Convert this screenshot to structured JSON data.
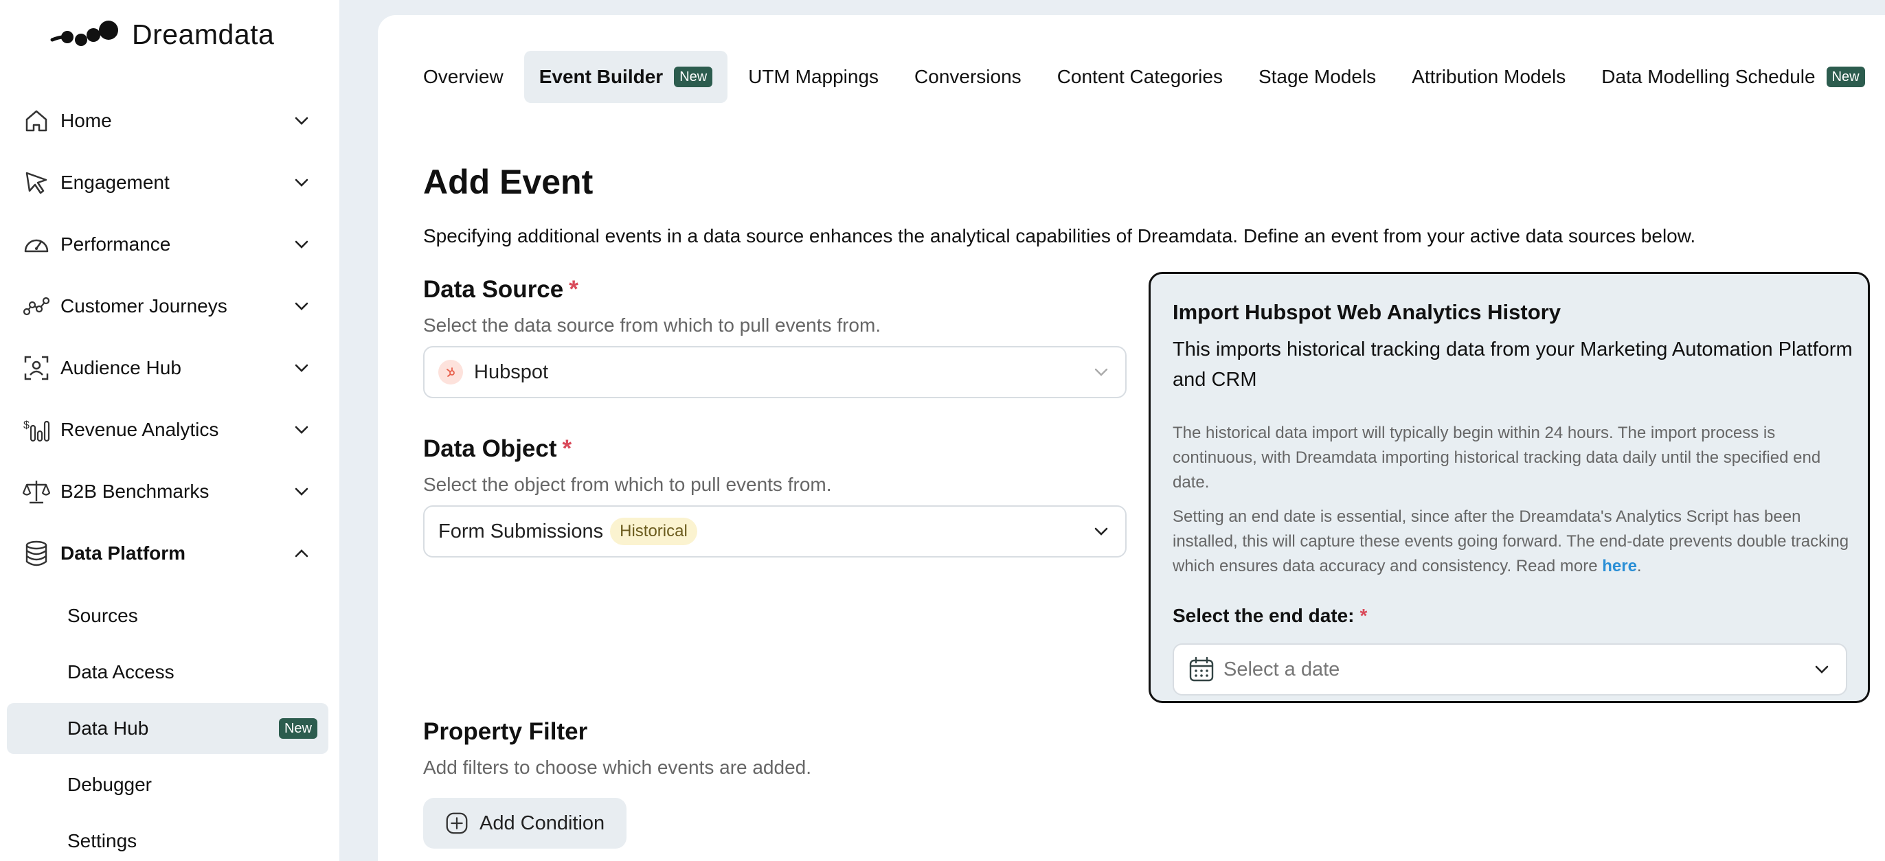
{
  "brand": {
    "name": "Dreamdata"
  },
  "sidebar": {
    "items": [
      {
        "label": "Home",
        "icon": "home-icon",
        "expanded": false
      },
      {
        "label": "Engagement",
        "icon": "cursor-icon",
        "expanded": false
      },
      {
        "label": "Performance",
        "icon": "gauge-icon",
        "expanded": false
      },
      {
        "label": "Customer Journeys",
        "icon": "journey-icon",
        "expanded": false
      },
      {
        "label": "Audience Hub",
        "icon": "audience-icon",
        "expanded": false
      },
      {
        "label": "Revenue Analytics",
        "icon": "revenue-icon",
        "expanded": false
      },
      {
        "label": "B2B Benchmarks",
        "icon": "scale-icon",
        "expanded": false
      },
      {
        "label": "Data Platform",
        "icon": "database-icon",
        "expanded": true
      }
    ],
    "sub_items": [
      {
        "label": "Sources"
      },
      {
        "label": "Data Access"
      },
      {
        "label": "Data Hub",
        "badge": "New",
        "active": true
      },
      {
        "label": "Debugger"
      },
      {
        "label": "Settings"
      }
    ]
  },
  "tabs": [
    {
      "label": "Overview"
    },
    {
      "label": "Event Builder",
      "badge": "New",
      "active": true
    },
    {
      "label": "UTM Mappings"
    },
    {
      "label": "Conversions"
    },
    {
      "label": "Content Categories"
    },
    {
      "label": "Stage Models"
    },
    {
      "label": "Attribution Models"
    },
    {
      "label": "Data Modelling Schedule",
      "badge": "New"
    }
  ],
  "page": {
    "title": "Add Event",
    "intro": "Specifying additional events in a data source enhances the analytical capabilities of Dreamdata. Define an event from your active data sources below."
  },
  "data_source": {
    "title": "Data Source",
    "required": "*",
    "help": "Select the data source from which to pull events from.",
    "value": "Hubspot"
  },
  "data_object": {
    "title": "Data Object",
    "required": "*",
    "help": "Select the object from which to pull events from.",
    "value": "Form Submissions",
    "tag": "Historical"
  },
  "import_panel": {
    "title": "Import Hubspot Web Analytics History",
    "subtitle": "This imports historical tracking data from your Marketing Automation Platform and CRM",
    "para1": "The historical data import will typically begin within 24 hours. The import process is continuous, with Dreamdata importing historical tracking data daily until the specified end date.",
    "para2": "Setting an end date is essential, since after the Dreamdata's Analytics Script has been installed, this will capture these events going forward. The end-date prevents double tracking which ensures data accuracy and consistency. Read more",
    "link": "here",
    "link_suffix": ".",
    "date_label": "Select the end date:",
    "required": "*",
    "date_placeholder": "Select a date"
  },
  "property_filter": {
    "title": "Property Filter",
    "help": "Add filters to choose which events are added.",
    "button": "Add Condition"
  },
  "colors": {
    "accent_badge": "#2c5c4e",
    "required": "#d94a5a",
    "link": "#2a8fd6"
  }
}
